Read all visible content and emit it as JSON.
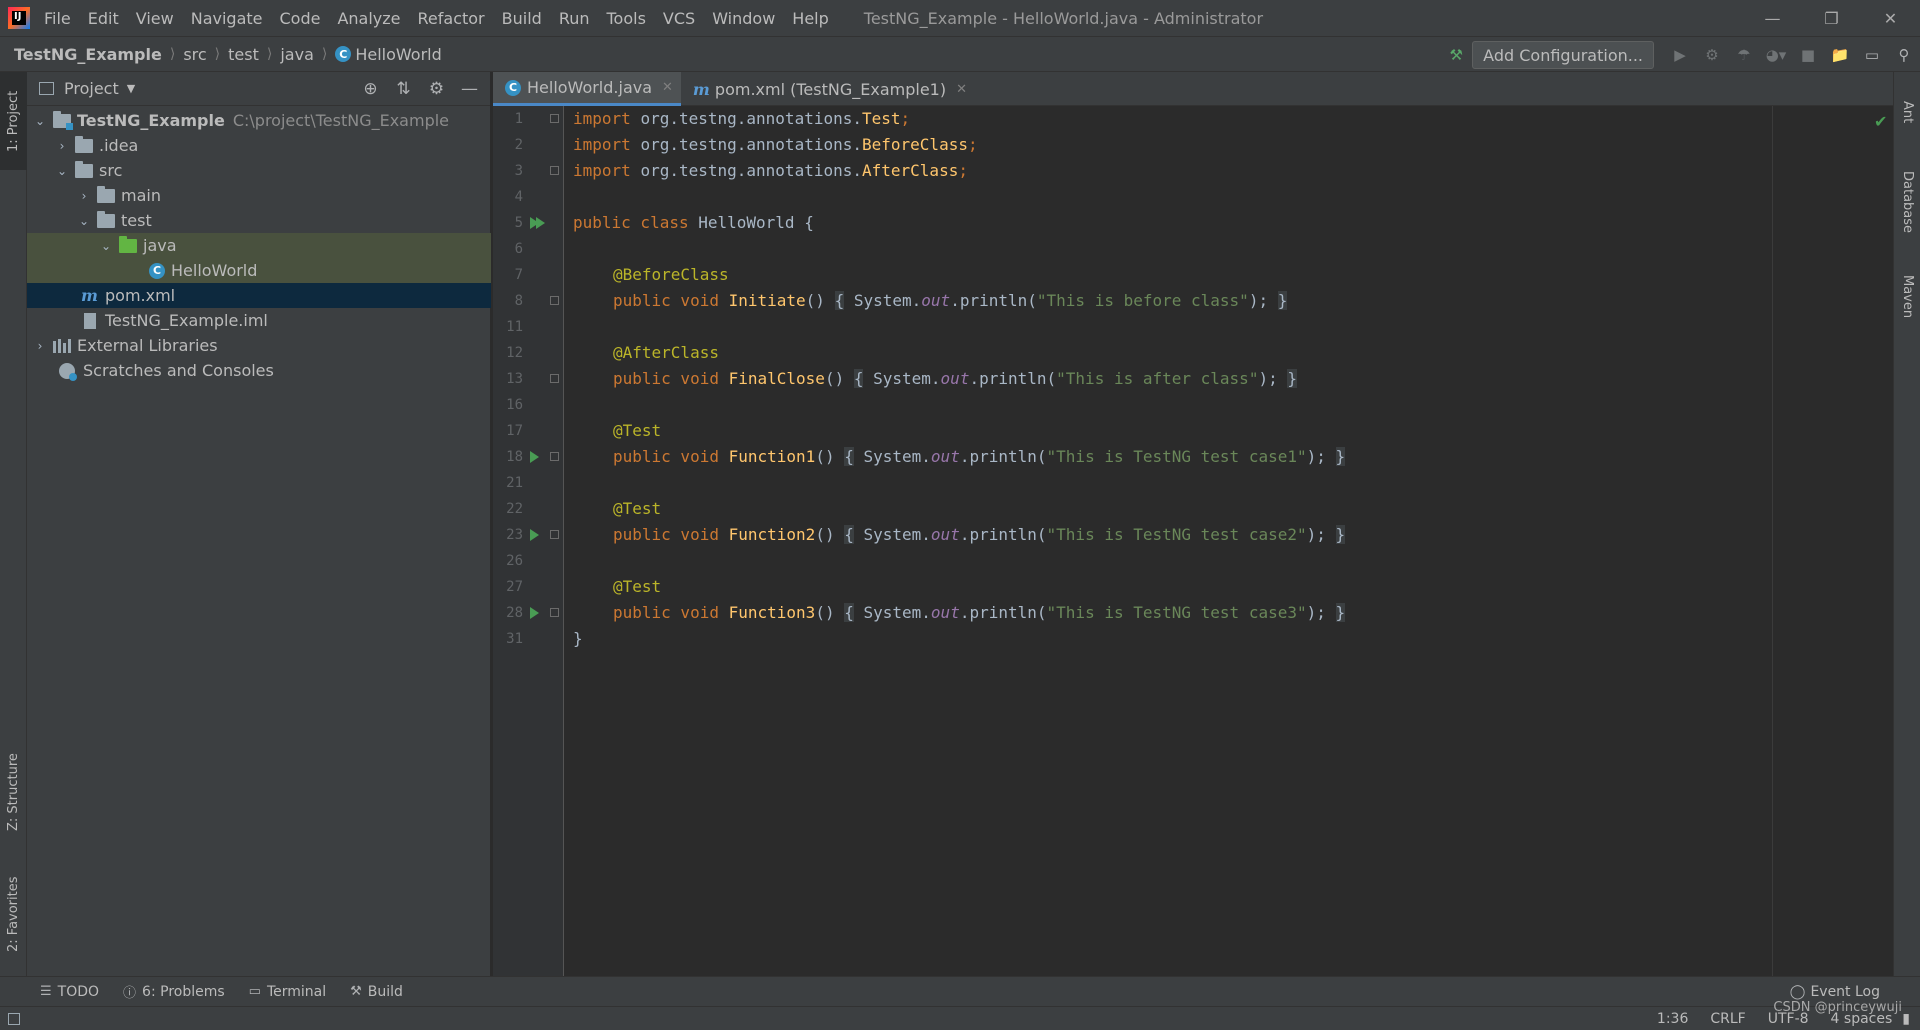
{
  "menubar": {
    "items": [
      "File",
      "Edit",
      "View",
      "Navigate",
      "Code",
      "Analyze",
      "Refactor",
      "Build",
      "Run",
      "Tools",
      "VCS",
      "Window",
      "Help"
    ],
    "window_title": "TestNG_Example - HelloWorld.java - Administrator",
    "logo_text": "IJ"
  },
  "breadcrumb": {
    "items": [
      "TestNG_Example",
      "src",
      "test",
      "java",
      "HelloWorld"
    ]
  },
  "toolbar": {
    "add_configuration": "Add Configuration..."
  },
  "left_stripe": {
    "project": "1: Project",
    "structure": "Z: Structure",
    "favorites": "2: Favorites"
  },
  "right_stripe": {
    "ant": "Ant",
    "database": "Database",
    "maven": "Maven"
  },
  "project_panel": {
    "title": "Project",
    "tree": [
      {
        "label": "TestNG_Example",
        "path": "C:\\project\\TestNG_Example"
      },
      {
        "label": ".idea"
      },
      {
        "label": "src"
      },
      {
        "label": "main"
      },
      {
        "label": "test"
      },
      {
        "label": "java"
      },
      {
        "label": "HelloWorld"
      },
      {
        "label": "pom.xml"
      },
      {
        "label": "TestNG_Example.iml"
      },
      {
        "label": "External Libraries"
      },
      {
        "label": "Scratches and Consoles"
      }
    ]
  },
  "editor_tabs": [
    {
      "label": "HelloWorld.java"
    },
    {
      "label": "pom.xml (TestNG_Example1)"
    }
  ],
  "editor": {
    "line_numbers": [
      "1",
      "2",
      "3",
      "4",
      "5",
      "6",
      "7",
      "8",
      "11",
      "12",
      "13",
      "16",
      "17",
      "18",
      "21",
      "22",
      "23",
      "26",
      "27",
      "28",
      "31"
    ],
    "code": {
      "import_kw": "import",
      "imports": [
        "org.testng.annotations.",
        "org.testng.annotations.",
        "org.testng.annotations."
      ],
      "import_names": [
        "Test",
        "BeforeClass",
        "AfterClass"
      ],
      "semicolon": ";",
      "public_class": "public class",
      "class_name": " HelloWorld {",
      "public_void": "public void",
      "before_ann": "@BeforeClass",
      "after_ann": "@AfterClass",
      "test_ann": "@Test",
      "methods": [
        "Initiate",
        "FinalClose",
        "Function1",
        "Function2",
        "Function3"
      ],
      "parens": "()",
      "open_brace": "{",
      "close_brace": "}",
      "system": " System.",
      "out": "out",
      "println": ".println(",
      "strings": [
        "\"This is before class\"",
        "\"This is after class\"",
        "\"This is TestNG test case1\"",
        "\"This is TestNG test case2\"",
        "\"This is TestNG test case3\""
      ],
      "end_call": ");",
      "final_brace": "}"
    }
  },
  "bottom_bar": {
    "todo": "TODO",
    "problems": "6: Problems",
    "terminal": "Terminal",
    "build": "Build",
    "event_log": "Event Log"
  },
  "status_bar": {
    "position": "1:36",
    "line_sep": "CRLF",
    "encoding": "UTF-8",
    "indent": "4 spaces"
  },
  "watermark": "CSDN @princeywuji",
  "colors": {
    "keyword": "#cc7832",
    "annotation": "#bbb529",
    "method": "#ffc66d",
    "string": "#6a8759",
    "run_green": "#499c54",
    "selection_blue": "#0d293e"
  }
}
